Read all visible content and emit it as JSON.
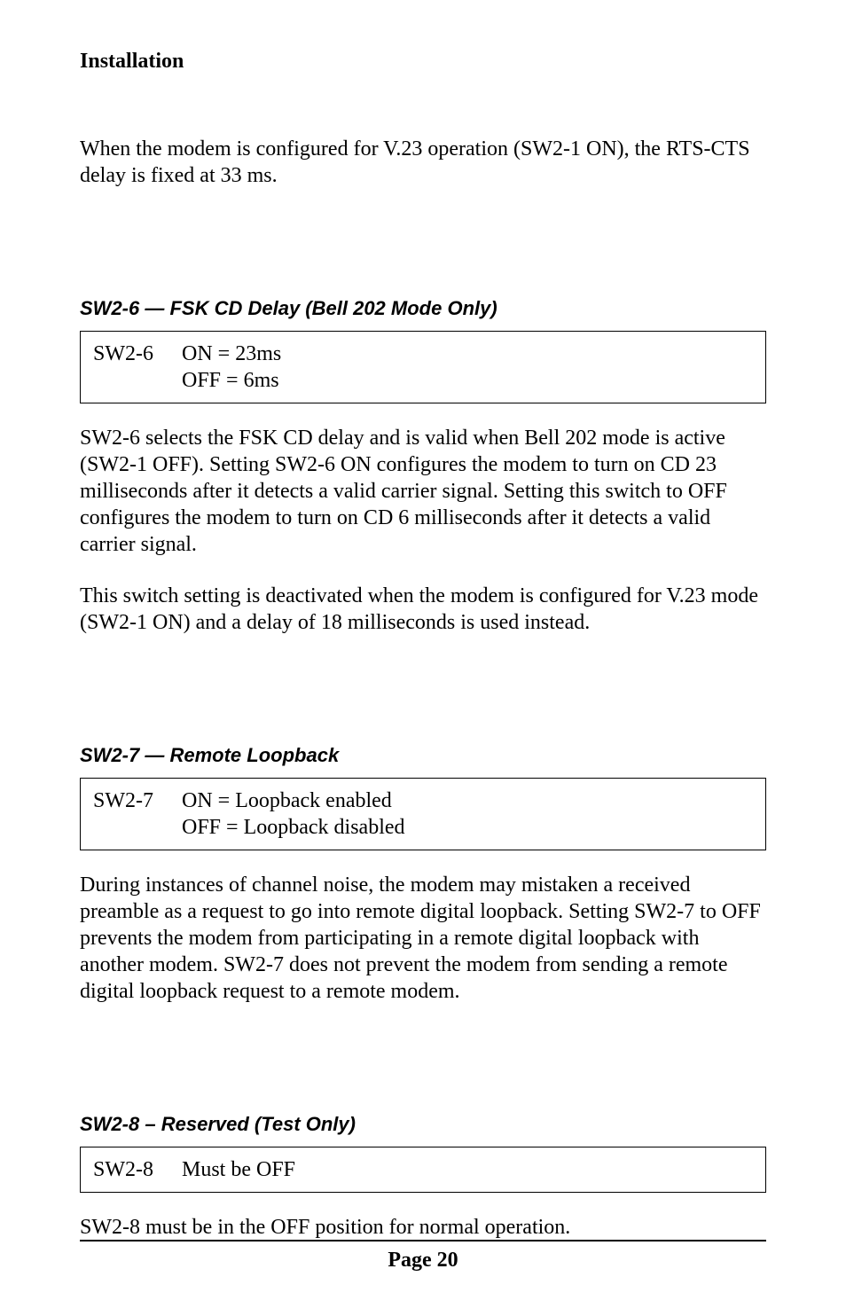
{
  "header": {
    "section": "Installation"
  },
  "intro_para": "When the modem is configured for V.23 operation (SW2-1 ON), the RTS-CTS delay is fixed at 33 ms.",
  "sw26": {
    "heading_prefix": "SW2-6",
    "heading_dash": " — ",
    "heading_title": "FSK CD Delay (Bell 202 Mode Only)",
    "box_label": "SW2-6",
    "box_on": "ON = 23ms",
    "box_off": "OFF = 6ms",
    "para1": "SW2-6 selects the FSK CD delay and is valid when Bell 202 mode is active (SW2-1 OFF). Setting SW2-6 ON configures the modem to turn on CD 23 milliseconds after it detects a valid carrier signal. Setting this switch to OFF configures the modem to turn on CD 6 milliseconds after it detects a valid carrier signal.",
    "para2": "This switch setting is deactivated when the modem is configured for V.23 mode (SW2-1 ON) and a delay of 18 milliseconds is used instead."
  },
  "sw27": {
    "heading_prefix": "SW2-7",
    "heading_dash": " — ",
    "heading_title": "Remote Loopback",
    "box_label": "SW2-7",
    "box_on": "ON = Loopback enabled",
    "box_off": "OFF = Loopback disabled",
    "para1": "During instances of channel noise, the modem may mistaken a received preamble as a request to go into remote digital loopback. Setting SW2-7 to OFF prevents the modem from participating in a remote digital loopback with another modem. SW2-7 does not prevent the modem from sending a remote digital loopback request to a remote modem."
  },
  "sw28": {
    "heading_prefix": "SW2-8",
    "heading_dash": " – ",
    "heading_title": "Reserved (Test Only)",
    "box_label": "SW2-8",
    "box_val": "Must be OFF",
    "para1": "SW2-8 must be in the OFF position for normal operation."
  },
  "footer": {
    "page_label": "Page 20"
  }
}
